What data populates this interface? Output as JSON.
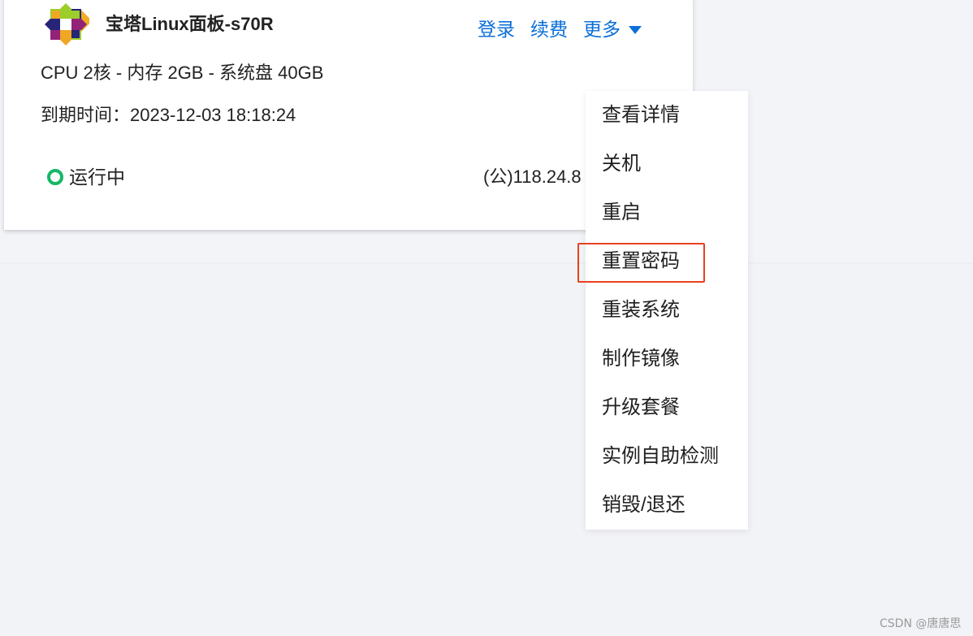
{
  "card": {
    "title": "宝塔Linux面板-s70R",
    "logo_icon": "centos-logo-icon",
    "specs": "CPU 2核 - 内存 2GB - 系统盘 40GB",
    "expiry": "到期时间：2023-12-03 18:18:24",
    "status": "运行中",
    "status_color": "#16b665",
    "ip": "(公)118.24.8"
  },
  "actions": {
    "login": "登录",
    "renew": "续费",
    "more": "更多",
    "more_icon": "caret-down-icon",
    "link_color": "#0b6fd8"
  },
  "menu": {
    "items": [
      "查看详情",
      "关机",
      "重启",
      "重置密码",
      "重装系统",
      "制作镜像",
      "升级套餐",
      "实例自助检测",
      "销毁/退还"
    ],
    "highlighted": "重置密码",
    "highlight_color": "#e8401f"
  },
  "watermark": "CSDN @唐唐思"
}
